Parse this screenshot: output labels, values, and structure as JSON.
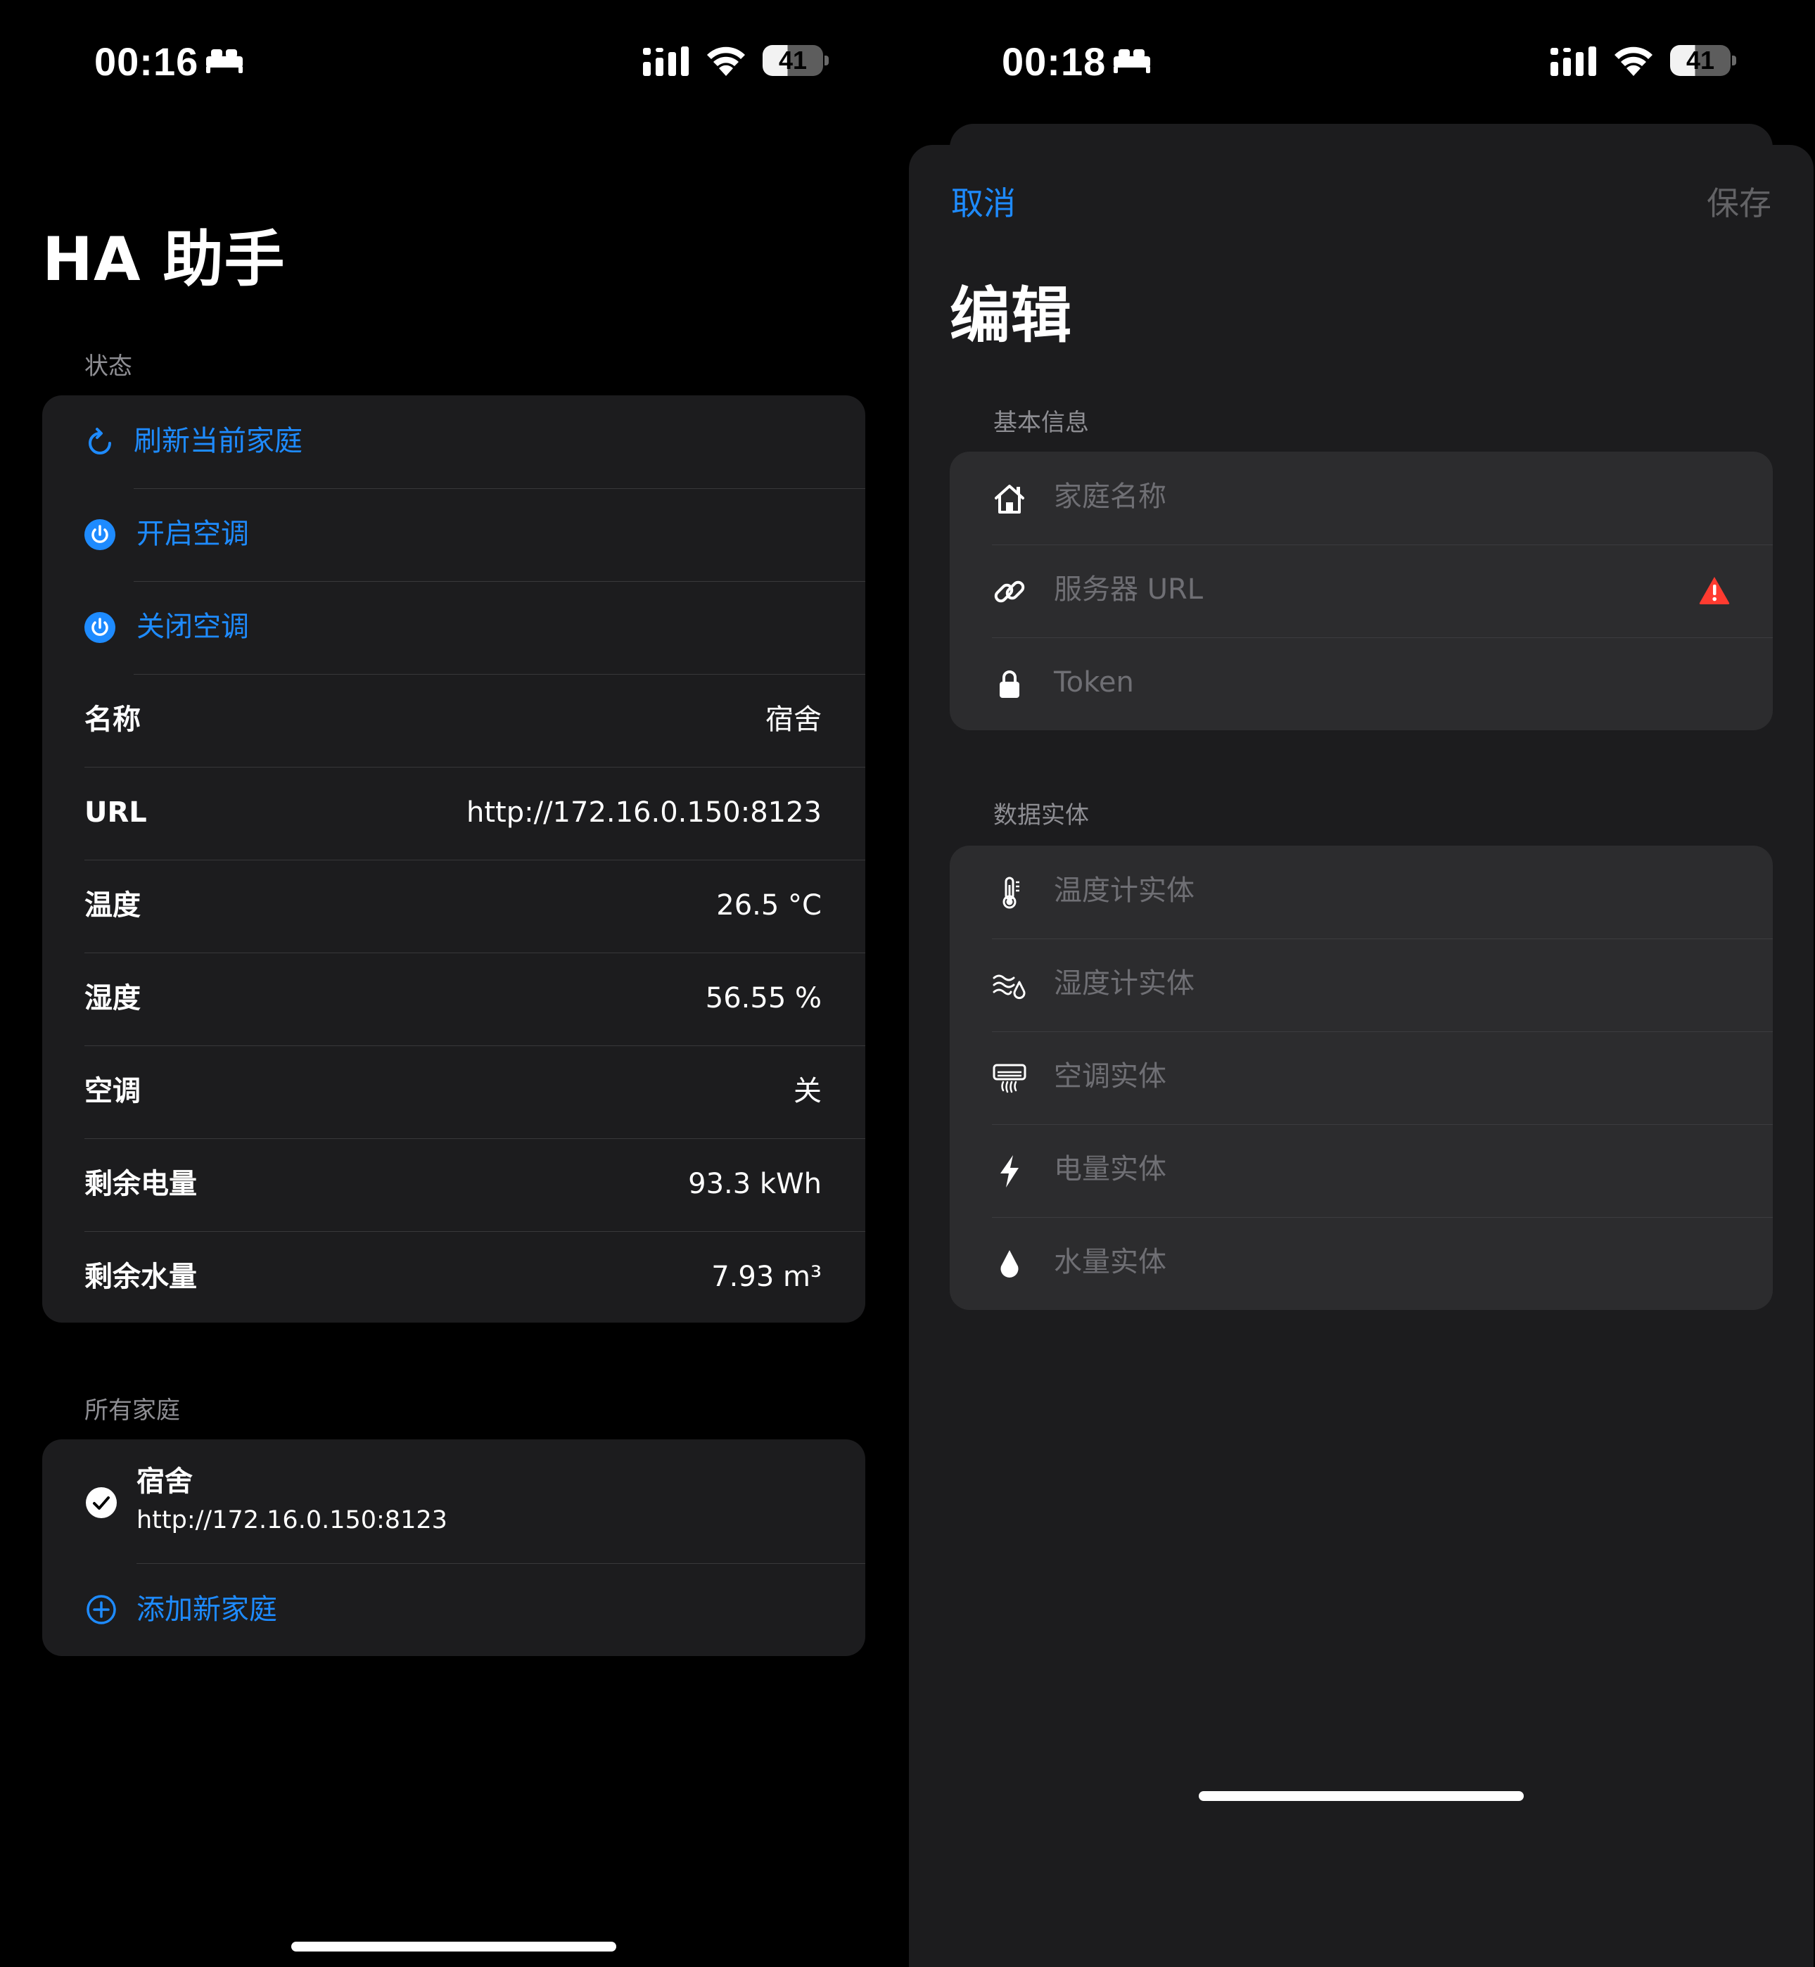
{
  "left_screen": {
    "status_bar": {
      "time": "00:16",
      "battery": "41"
    },
    "title": "HA 助手",
    "status_section": {
      "header": "状态",
      "actions": [
        {
          "label": "刷新当前家庭",
          "icon": "refresh-icon"
        },
        {
          "label": "开启空调",
          "icon": "power-icon"
        },
        {
          "label": "关闭空调",
          "icon": "power-icon"
        }
      ],
      "info_rows": [
        {
          "label": "名称",
          "value": "宿舍"
        },
        {
          "label": "URL",
          "value": "http://172.16.0.150:8123"
        },
        {
          "label": "温度",
          "value": "26.5 °C"
        },
        {
          "label": "湿度",
          "value": "56.55 %"
        },
        {
          "label": "空调",
          "value": "关"
        },
        {
          "label": "剩余电量",
          "value": "93.3 kWh"
        },
        {
          "label": "剩余水量",
          "value": "7.93 m³"
        }
      ]
    },
    "homes_section": {
      "header": "所有家庭",
      "homes": [
        {
          "name": "宿舍",
          "url": "http://172.16.0.150:8123",
          "selected": true
        }
      ],
      "add_label": "添加新家庭"
    }
  },
  "right_screen": {
    "status_bar": {
      "time": "00:18",
      "battery": "41"
    },
    "nav": {
      "cancel": "取消",
      "save": "保存"
    },
    "title": "编辑",
    "basic_section": {
      "header": "基本信息",
      "fields": [
        {
          "placeholder": "家庭名称",
          "icon": "house-icon"
        },
        {
          "placeholder": "服务器 URL",
          "icon": "link-icon",
          "warning": true
        },
        {
          "placeholder": "Token",
          "icon": "lock-icon"
        }
      ]
    },
    "entity_section": {
      "header": "数据实体",
      "fields": [
        {
          "placeholder": "温度计实体",
          "icon": "thermometer-icon"
        },
        {
          "placeholder": "湿度计实体",
          "icon": "humidity-icon"
        },
        {
          "placeholder": "空调实体",
          "icon": "air-conditioner-icon"
        },
        {
          "placeholder": "电量实体",
          "icon": "bolt-icon"
        },
        {
          "placeholder": "水量实体",
          "icon": "drop-icon"
        }
      ]
    }
  },
  "colors": {
    "accent": "#1e8bff",
    "background": "#000000",
    "card": "#1c1c1e",
    "sheet_field": "#2c2c2e",
    "secondary_text": "#8e8e93",
    "warning": "#ff3b30"
  }
}
